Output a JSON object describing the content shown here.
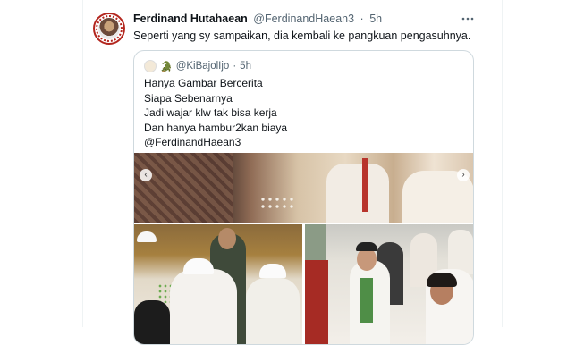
{
  "tweet": {
    "author_name": "Ferdinand Hutahaean",
    "author_handle": "@FerdinandHaean3",
    "separator": "·",
    "time": "5h",
    "more_icon": "more-horizontal-icon",
    "text": "Seperti yang sy sampaikan, dia kembali ke pangkuan pengasuhnya."
  },
  "quote": {
    "emoji": "🐊",
    "handle": "@KiBajolIjo",
    "separator": "·",
    "time": "5h",
    "lines": [
      "Hanya Gambar Bercerita",
      "Siapa Sebenarnya",
      "Jadi wajar klw tak bisa kerja",
      "Dan hanya hambur2kan biaya",
      "@FerdinandHaean3"
    ],
    "nav_prev": "‹",
    "nav_next": "›"
  }
}
